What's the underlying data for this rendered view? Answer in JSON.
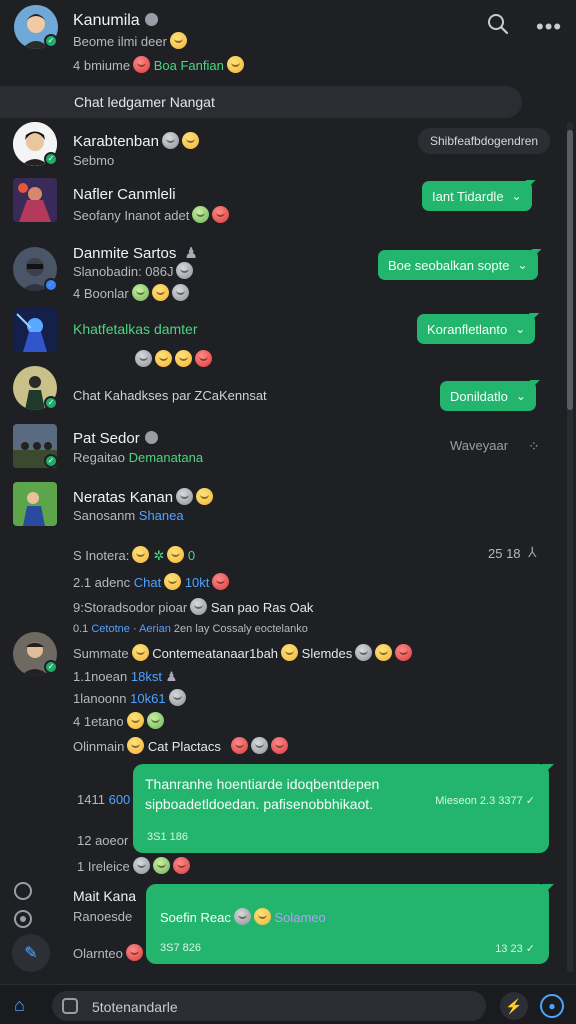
{
  "header": {
    "title": "Kanumila",
    "status": "Beome ilmi deer",
    "meta_prefix": "4 bmiume",
    "meta_green": "Boa Fanfian"
  },
  "search_bar": {
    "text": "Chat ledgamer Nangat"
  },
  "chats": [
    {
      "name": "Karabtenban",
      "sub": "Sebmo",
      "pill": "Shibfeafbdogendren"
    },
    {
      "name": "Nafler Canmleli",
      "sub": "Seofany Inanot adet",
      "pill": "Iant Tidardle"
    },
    {
      "name": "Danmite Sartos",
      "sub": "Slanobadin: 086J",
      "sub2": "4 Boonlar",
      "pill": "Boe seobalkan sopte"
    },
    {
      "name": "Khatfetalkas damter",
      "pill": "Koranfletlanto"
    },
    {
      "name": "Chat Kahadkses par ZCaKennsat",
      "pill": "Donildatlo"
    },
    {
      "name": "Pat Sedor",
      "sub_prefix": "Regaitao",
      "sub_green": "Demanatana",
      "right": "Waveyaar"
    },
    {
      "name": "Neratas Kanan",
      "sub_prefix": "Sanosanm",
      "sub_blue": "Shanea"
    }
  ],
  "stats": {
    "line1": "S Inotera:",
    "line1_num": "0",
    "line1_right": "25 18",
    "line2": "2.1 adenc",
    "line2_blue": "Chat",
    "line2_mid": "10kt",
    "line3": "9:Storadsodor pioar",
    "line3_right": "San pao Ras Oak",
    "line4_prefix": "0.1",
    "line4_blue1": "Cetotne",
    "line4_blue2": "Aerian",
    "line4_rest": "2en lay Cossaly eoctelanko"
  },
  "detail": {
    "row1": "Summate",
    "row1_mid": "Contemeatanaar1bah",
    "row1_right": "Slemdes",
    "row2": "1.1noean",
    "row2_blue": "18kst",
    "row3": "1lanoonn",
    "row3_blue": "10k61",
    "row4": "4 1etano",
    "row5": "Olinmain",
    "row5_mid": "Cat Plactacs"
  },
  "message1": {
    "left": "1411",
    "left_blue": "600",
    "text": "Thanranhe hoentiarde idoqbentdepen sipboadetldoedan. pafisenobbhikaot.",
    "meta": "Mieseon 2.3 3377",
    "sub": "3S1 186",
    "below_left": "12 aoeor",
    "below_left2": "1 Ireleice"
  },
  "message2": {
    "name": "Mait Kana",
    "left": "Ranoesde",
    "left2": "Olarnteo",
    "text": "Soefin Reac",
    "text_purple": "Solameo",
    "sub": "3S7 826",
    "time": "13 23"
  },
  "bottom_bar": {
    "input_text": "5totenandarle"
  },
  "colors": {
    "accent": "#23b56d",
    "background": "#1f2024",
    "link": "#4ea3ff"
  }
}
